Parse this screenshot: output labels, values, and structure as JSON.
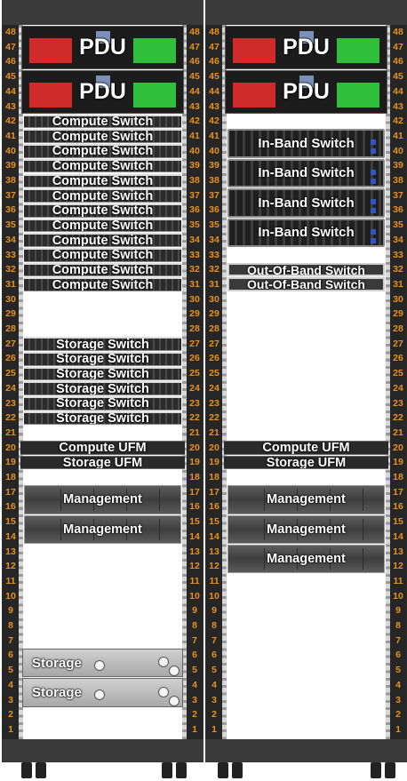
{
  "units": [
    "48",
    "47",
    "46",
    "45",
    "44",
    "43",
    "42",
    "41",
    "40",
    "39",
    "38",
    "37",
    "36",
    "35",
    "34",
    "33",
    "32",
    "31",
    "30",
    "29",
    "28",
    "27",
    "26",
    "25",
    "24",
    "23",
    "22",
    "21",
    "20",
    "19",
    "18",
    "17",
    "16",
    "15",
    "14",
    "13",
    "12",
    "11",
    "10",
    "9",
    "8",
    "7",
    "6",
    "5",
    "4",
    "3",
    "2",
    "1"
  ],
  "racks": [
    {
      "devices": [
        {
          "kind": "pdu",
          "label": "PDU",
          "top_u": 48,
          "units": 3
        },
        {
          "kind": "pdu",
          "label": "PDU",
          "top_u": 45,
          "units": 3
        },
        {
          "kind": "switch-1u",
          "label": "Compute Switch",
          "top_u": 42,
          "units": 1
        },
        {
          "kind": "switch-1u",
          "label": "Compute Switch",
          "top_u": 41,
          "units": 1
        },
        {
          "kind": "switch-1u",
          "label": "Compute Switch",
          "top_u": 40,
          "units": 1
        },
        {
          "kind": "switch-1u",
          "label": "Compute Switch",
          "top_u": 39,
          "units": 1
        },
        {
          "kind": "switch-1u",
          "label": "Compute Switch",
          "top_u": 38,
          "units": 1
        },
        {
          "kind": "switch-1u",
          "label": "Compute Switch",
          "top_u": 37,
          "units": 1
        },
        {
          "kind": "switch-1u",
          "label": "Compute Switch",
          "top_u": 36,
          "units": 1
        },
        {
          "kind": "switch-1u",
          "label": "Compute Switch",
          "top_u": 35,
          "units": 1
        },
        {
          "kind": "switch-1u",
          "label": "Compute Switch",
          "top_u": 34,
          "units": 1
        },
        {
          "kind": "switch-1u",
          "label": "Compute Switch",
          "top_u": 33,
          "units": 1
        },
        {
          "kind": "switch-1u",
          "label": "Compute Switch",
          "top_u": 32,
          "units": 1
        },
        {
          "kind": "switch-1u",
          "label": "Compute Switch",
          "top_u": 31,
          "units": 1
        },
        {
          "kind": "switch-1u",
          "label": "Storage Switch",
          "top_u": 27,
          "units": 1
        },
        {
          "kind": "switch-1u",
          "label": "Storage Switch",
          "top_u": 26,
          "units": 1
        },
        {
          "kind": "switch-1u",
          "label": "Storage Switch",
          "top_u": 25,
          "units": 1
        },
        {
          "kind": "switch-1u",
          "label": "Storage Switch",
          "top_u": 24,
          "units": 1
        },
        {
          "kind": "switch-1u",
          "label": "Storage Switch",
          "top_u": 23,
          "units": 1
        },
        {
          "kind": "switch-1u",
          "label": "Storage Switch",
          "top_u": 22,
          "units": 1
        },
        {
          "kind": "ufm",
          "label": "Compute UFM",
          "top_u": 20,
          "units": 1
        },
        {
          "kind": "ufm",
          "label": "Storage UFM",
          "top_u": 19,
          "units": 1
        },
        {
          "kind": "mgmt",
          "label": "Management",
          "top_u": 17,
          "units": 2
        },
        {
          "kind": "mgmt",
          "label": "Management",
          "top_u": 15,
          "units": 2
        },
        {
          "kind": "storage",
          "label": "Storage",
          "top_u": 6,
          "units": 2
        },
        {
          "kind": "storage",
          "label": "Storage",
          "top_u": 4,
          "units": 2
        }
      ]
    },
    {
      "devices": [
        {
          "kind": "pdu",
          "label": "PDU",
          "top_u": 48,
          "units": 3
        },
        {
          "kind": "pdu",
          "label": "PDU",
          "top_u": 45,
          "units": 3
        },
        {
          "kind": "inband",
          "label": "In-Band Switch",
          "top_u": 41,
          "units": 2
        },
        {
          "kind": "inband",
          "label": "In-Band Switch",
          "top_u": 39,
          "units": 2
        },
        {
          "kind": "inband",
          "label": "In-Band Switch",
          "top_u": 37,
          "units": 2
        },
        {
          "kind": "inband",
          "label": "In-Band Switch",
          "top_u": 35,
          "units": 2
        },
        {
          "kind": "oob",
          "label": "Out-Of-Band Switch",
          "top_u": 32,
          "units": 1
        },
        {
          "kind": "oob",
          "label": "Out-Of-Band Switch",
          "top_u": 31,
          "units": 1
        },
        {
          "kind": "ufm",
          "label": "Compute UFM",
          "top_u": 20,
          "units": 1
        },
        {
          "kind": "ufm",
          "label": "Storage UFM",
          "top_u": 19,
          "units": 1
        },
        {
          "kind": "mgmt",
          "label": "Management",
          "top_u": 17,
          "units": 2
        },
        {
          "kind": "mgmt",
          "label": "Management",
          "top_u": 15,
          "units": 2
        },
        {
          "kind": "mgmt",
          "label": "Management",
          "top_u": 13,
          "units": 2
        }
      ]
    }
  ]
}
